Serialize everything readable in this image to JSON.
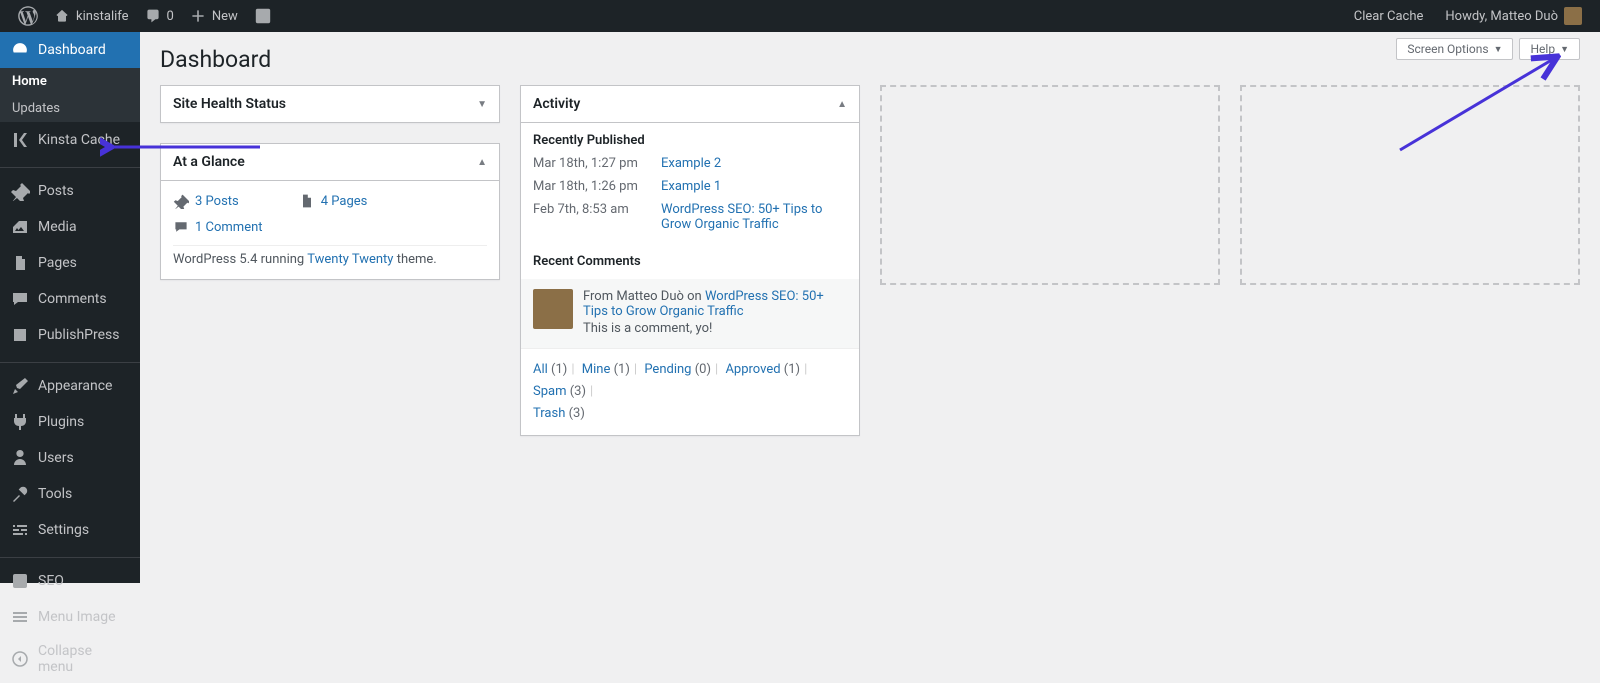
{
  "adminbar": {
    "site_name": "kinstalife",
    "comments_count": "0",
    "new_label": "New",
    "clear_cache": "Clear Cache",
    "howdy": "Howdy, Matteo Duò"
  },
  "sidebar": {
    "dashboard": "Dashboard",
    "home": "Home",
    "updates": "Updates",
    "kinsta_cache": "Kinsta Cache",
    "posts": "Posts",
    "media": "Media",
    "pages": "Pages",
    "comments": "Comments",
    "publishpress": "PublishPress",
    "appearance": "Appearance",
    "plugins": "Plugins",
    "users": "Users",
    "tools": "Tools",
    "settings": "Settings",
    "seo": "SEO",
    "menu_image": "Menu Image",
    "collapse": "Collapse menu"
  },
  "header": {
    "title": "Dashboard",
    "screen_options": "Screen Options",
    "help": "Help"
  },
  "site_health": {
    "title": "Site Health Status"
  },
  "glance": {
    "title": "At a Glance",
    "posts": "3 Posts",
    "pages": "4 Pages",
    "comments": "1 Comment",
    "version_pre": "WordPress 5.4 running ",
    "theme": "Twenty Twenty",
    "version_post": " theme."
  },
  "activity": {
    "title": "Activity",
    "recently_published": "Recently Published",
    "items": [
      {
        "date": "Mar 18th, 1:27 pm",
        "title": "Example 2"
      },
      {
        "date": "Mar 18th, 1:26 pm",
        "title": "Example 1"
      },
      {
        "date": "Feb 7th, 8:53 am",
        "title": "WordPress SEO: 50+ Tips to Grow Organic Traffic"
      }
    ],
    "recent_comments": "Recent Comments",
    "comment_from": "From Matteo Duò on ",
    "comment_post": "WordPress SEO: 50+ Tips to Grow Organic Traffic",
    "comment_body": "This is a comment, yo!",
    "filters": {
      "all": "All",
      "all_c": "(1)",
      "mine": "Mine",
      "mine_c": "(1)",
      "pending": "Pending",
      "pending_c": "(0)",
      "approved": "Approved",
      "approved_c": "(1)",
      "spam": "Spam",
      "spam_c": "(3)",
      "trash": "Trash",
      "trash_c": "(3)"
    }
  }
}
